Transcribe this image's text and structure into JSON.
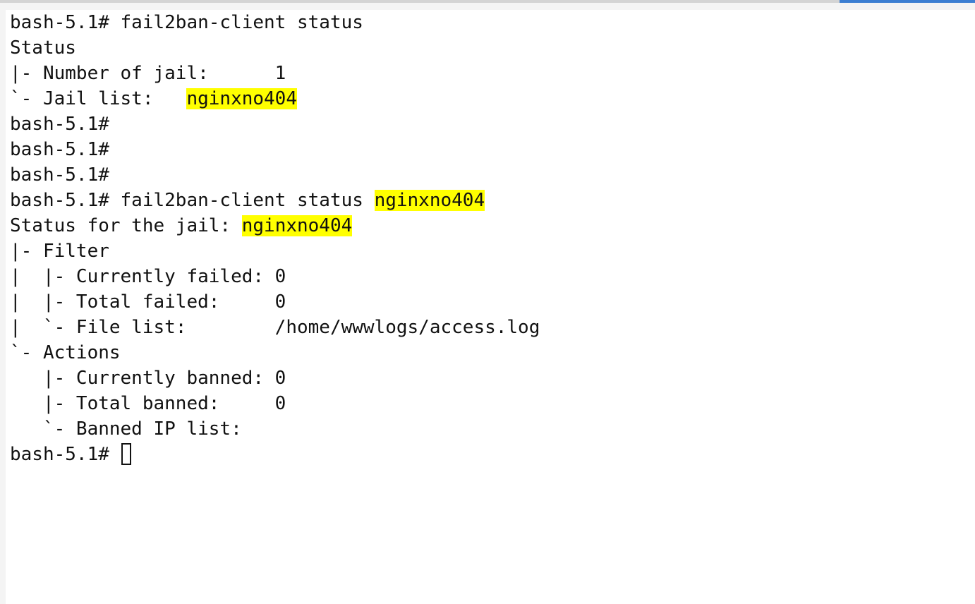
{
  "prompt": "bash-5.1#",
  "colors": {
    "highlight": "#ffff00",
    "text": "#111111",
    "accent": "#3d7fd2"
  },
  "terminal": {
    "lines": [
      {
        "pre": "bash-5.1# fail2ban-client status",
        "hl": "",
        "post": ""
      },
      {
        "pre": "Status",
        "hl": "",
        "post": ""
      },
      {
        "pre": "|- Number of jail:      1",
        "hl": "",
        "post": ""
      },
      {
        "pre": "`- Jail list:   ",
        "hl": "nginxno404",
        "post": ""
      },
      {
        "pre": "bash-5.1#",
        "hl": "",
        "post": ""
      },
      {
        "pre": "bash-5.1#",
        "hl": "",
        "post": ""
      },
      {
        "pre": "bash-5.1#",
        "hl": "",
        "post": ""
      },
      {
        "pre": "bash-5.1# fail2ban-client status ",
        "hl": "nginxno404",
        "post": ""
      },
      {
        "pre": "Status for the jail: ",
        "hl": "nginxno404",
        "post": ""
      },
      {
        "pre": "|- Filter",
        "hl": "",
        "post": ""
      },
      {
        "pre": "|  |- Currently failed: 0",
        "hl": "",
        "post": ""
      },
      {
        "pre": "|  |- Total failed:     0",
        "hl": "",
        "post": ""
      },
      {
        "pre": "|  `- File list:        /home/wwwlogs/access.log",
        "hl": "",
        "post": ""
      },
      {
        "pre": "`- Actions",
        "hl": "",
        "post": ""
      },
      {
        "pre": "   |- Currently banned: 0",
        "hl": "",
        "post": ""
      },
      {
        "pre": "   |- Total banned:     0",
        "hl": "",
        "post": ""
      },
      {
        "pre": "   `- Banned IP list:",
        "hl": "",
        "post": ""
      }
    ],
    "current_prompt": "bash-5.1# "
  }
}
